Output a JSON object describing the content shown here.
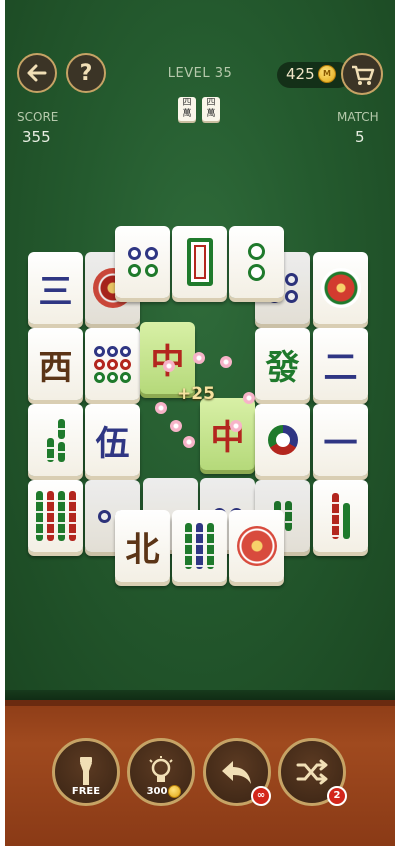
{
  "header": {
    "back_icon": "arrow-left-icon",
    "help_label": "?",
    "level_text": "LEVEL 35",
    "coins": "425",
    "coin_letter": "M",
    "cart_icon": "cart-icon"
  },
  "stats": {
    "score_label": "SCORE",
    "score_value": "355",
    "match_label": "MATCH",
    "match_value": "5"
  },
  "board": {
    "bonus_text": "+25",
    "tiles": {
      "r1c1": "三",
      "r2c1": "西",
      "r3c2": "伍",
      "r5c2": "北",
      "sel1": "中",
      "sel2": "中",
      "r2c5": "發",
      "r2c6": "二",
      "r3c6": "一"
    },
    "mini_tiles": [
      "四\n萬",
      "四\n萬"
    ]
  },
  "tools": {
    "flashlight_label": "FREE",
    "hint_label": "300",
    "undo_badge": "∞",
    "shuffle_badge": "2"
  },
  "colors": {
    "felt": "#245a2e",
    "wood": "#a04a1f",
    "button_border": "#c6a365",
    "selected_tile": "#c6e38f"
  }
}
